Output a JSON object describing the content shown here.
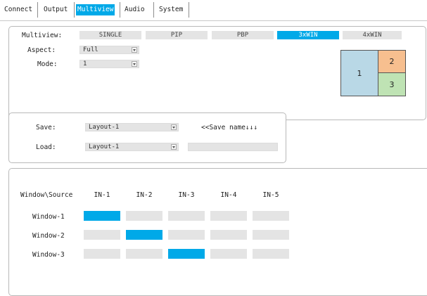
{
  "tabs": [
    "Connect",
    "Output",
    "Multiview",
    "Audio",
    "System"
  ],
  "active_tab": "Multiview",
  "multiview": {
    "label": "Multiview:",
    "modes": [
      "SINGLE",
      "PIP",
      "PBP",
      "3xWIN",
      "4xWIN"
    ],
    "active_mode": "3xWIN",
    "aspect_label": "Aspect:",
    "aspect_value": "Full",
    "mode_label": "Mode:",
    "mode_value": "1",
    "preview_windows": [
      "1",
      "2",
      "3"
    ],
    "preview_colors": {
      "w1": "#b9d8e6",
      "w2": "#f7bf8f",
      "w3": "#bfe3b4"
    }
  },
  "layout": {
    "save_label": "Save:",
    "save_value": "Layout-1",
    "save_name_hint": "<<Save name↓↓↓",
    "load_label": "Load:",
    "load_value": "Layout-1",
    "load_field": ""
  },
  "matrix": {
    "corner_label": "Window\\Source",
    "sources": [
      "IN-1",
      "IN-2",
      "IN-3",
      "IN-4",
      "IN-5"
    ],
    "windows": [
      "Window-1",
      "Window-2",
      "Window-3"
    ],
    "selected": [
      0,
      1,
      2
    ]
  },
  "colors": {
    "accent": "#00a9e8",
    "inactive": "#e4e4e4",
    "border": "#b9b9b9"
  }
}
